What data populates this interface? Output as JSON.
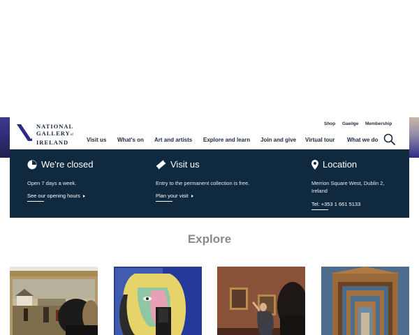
{
  "logo": {
    "line1": "NATIONAL",
    "line2": "GALLERY",
    "line2_small": "of",
    "line3": "IRELAND"
  },
  "utility_nav": [
    "Shop",
    "Gaeilge",
    "Membership"
  ],
  "main_nav": [
    "Visit us",
    "What's on",
    "Art and artists",
    "Explore and learn",
    "Join and give",
    "Virtual tour",
    "What we do"
  ],
  "info": {
    "closed": {
      "heading": "We're closed",
      "body": "Open 7 days a week.",
      "link": "See our opening hours"
    },
    "visit": {
      "heading": "Visit us",
      "body": "Entry to the permanent collection is free.",
      "link": "Plan your visit"
    },
    "location": {
      "heading": "Location",
      "address_line1": "Merrion Square West, Dublin 2,",
      "address_line2": "Ireland",
      "tel": "Tel: +353 1 661 5133"
    }
  },
  "explore": {
    "title": "Explore",
    "cards": [
      {
        "icon": "landscape-painting-icon"
      },
      {
        "icon": "portrait-painting-icon"
      },
      {
        "icon": "gallery-visitor-icon"
      },
      {
        "icon": "gallery-doorways-icon"
      }
    ]
  },
  "colors": {
    "navy": "#0f2a3f",
    "logo_purple": "#2b2a86",
    "heading_grey": "#8a8a8a"
  }
}
